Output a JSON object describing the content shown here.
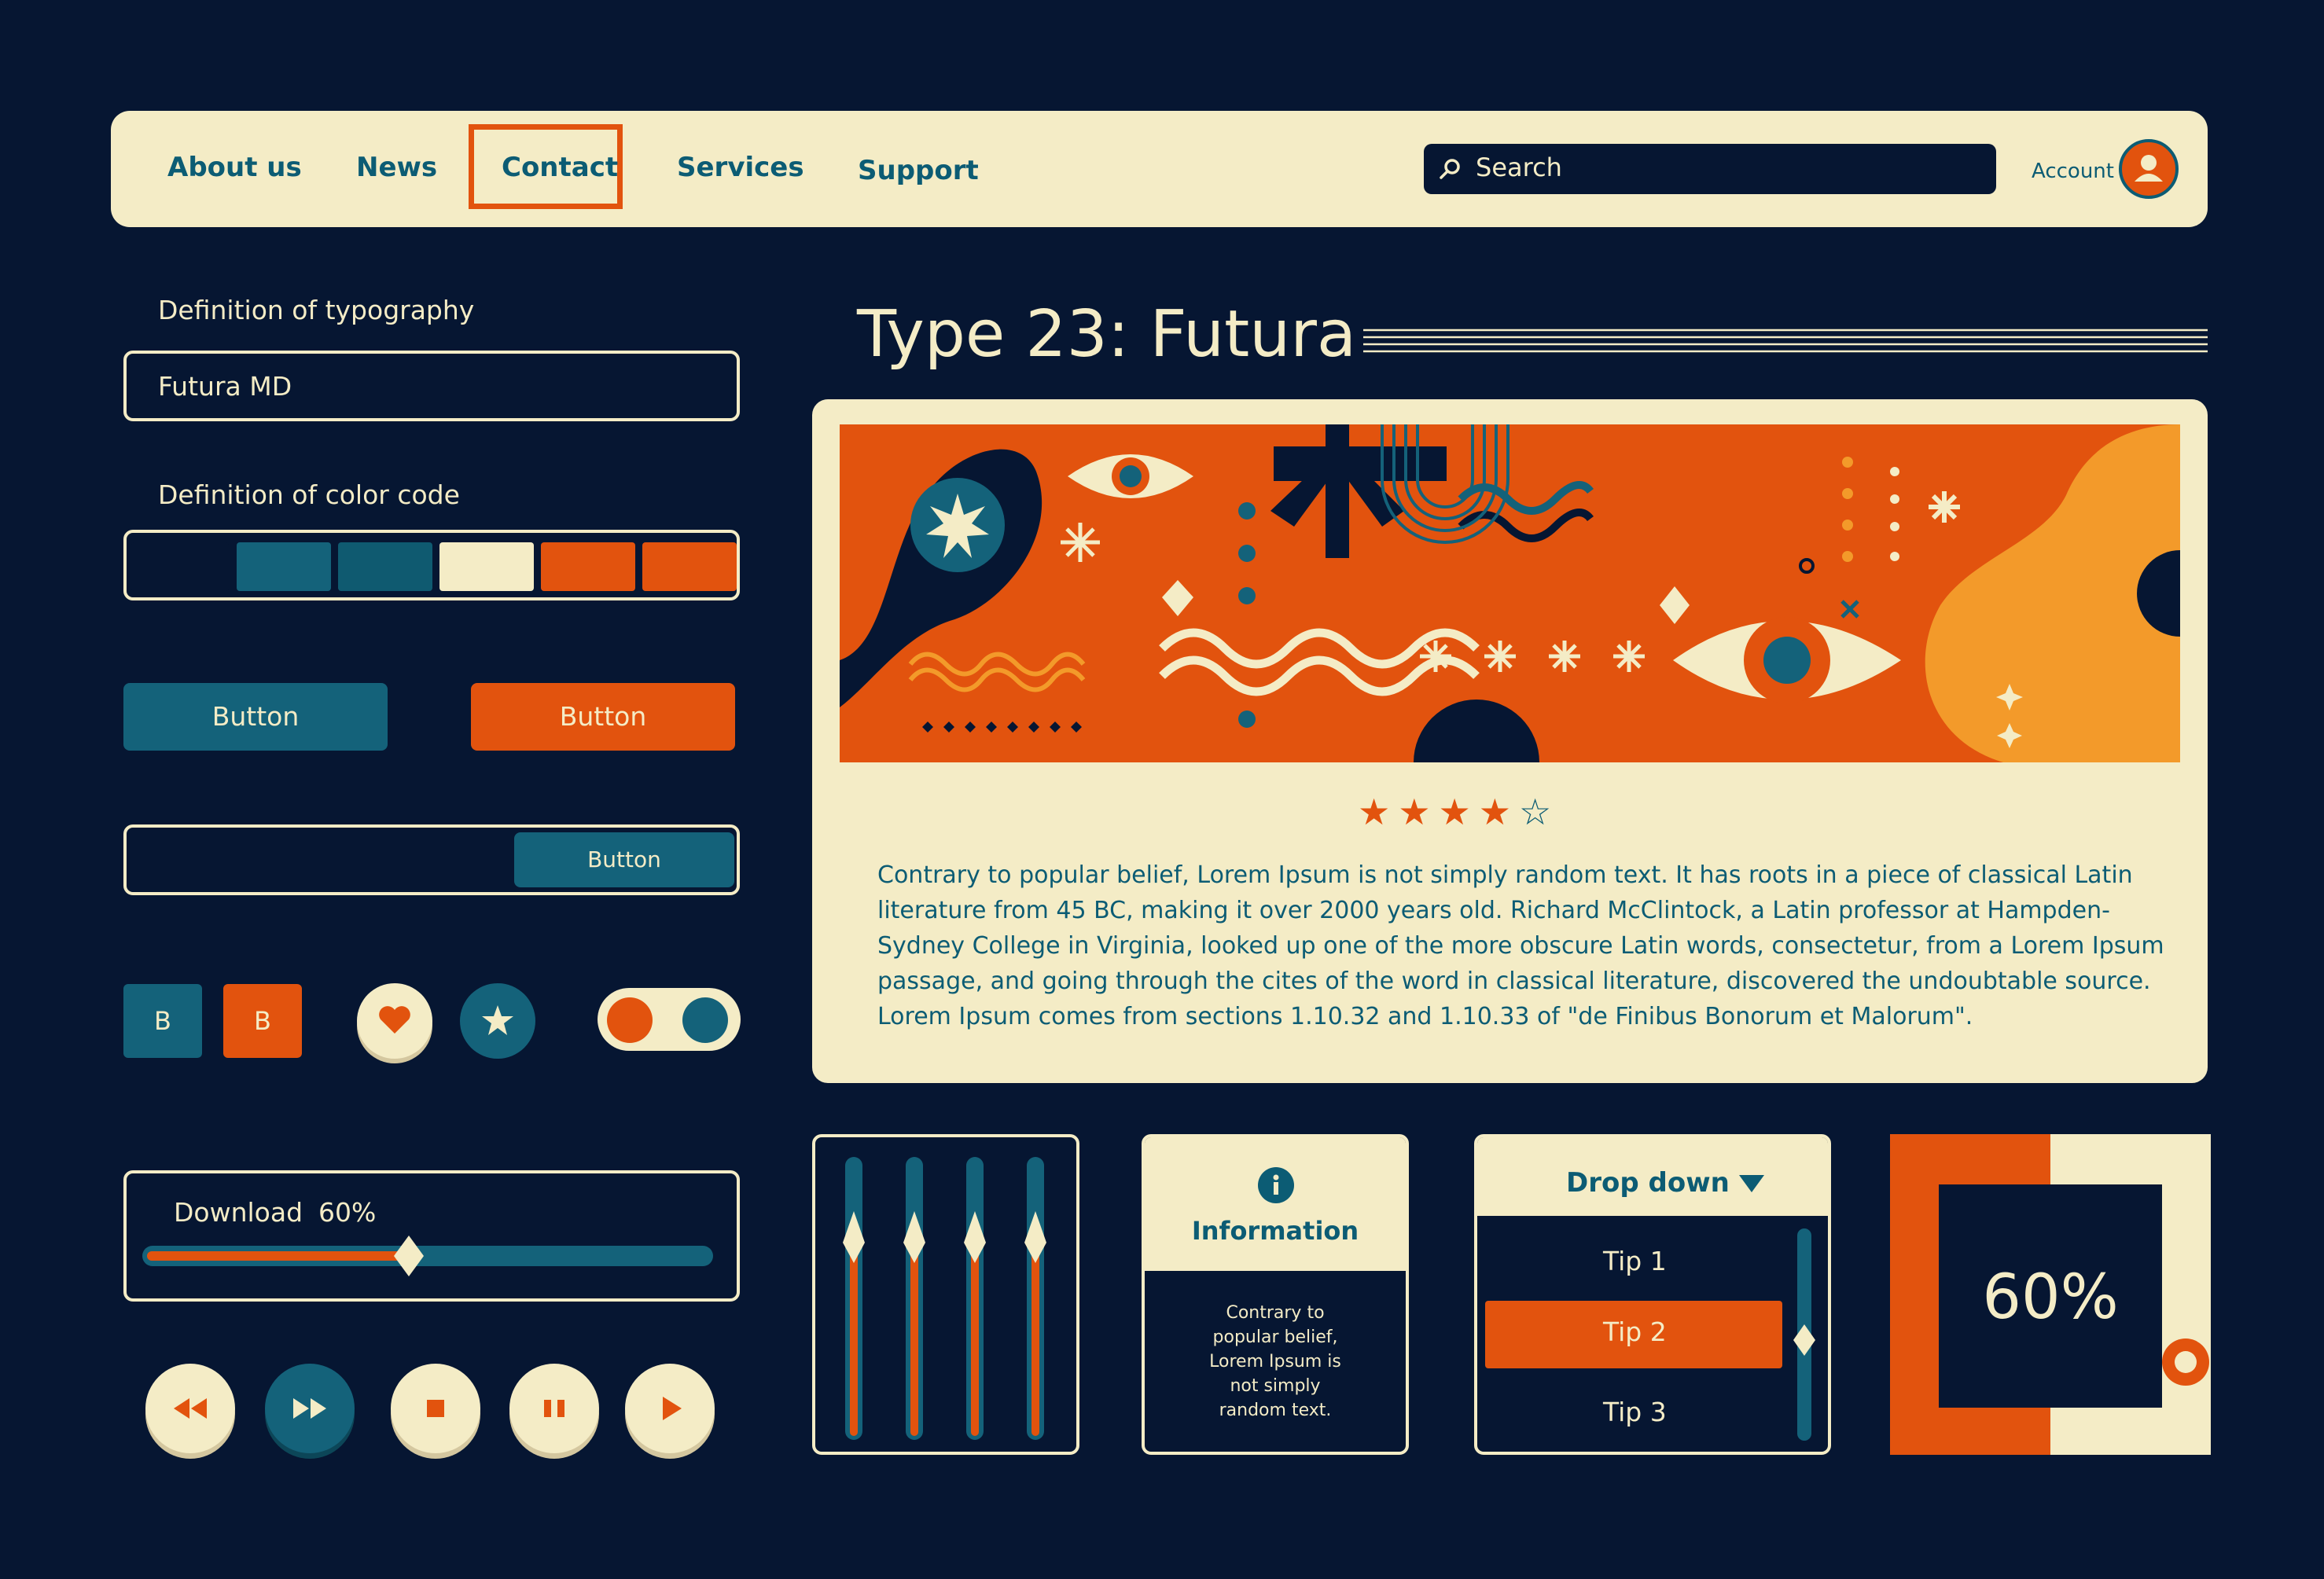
{
  "nav": {
    "items": [
      "About us",
      "News",
      "Contact",
      "Services",
      "Support"
    ],
    "active": "Contact",
    "search_placeholder": "Search",
    "account_label": "Account"
  },
  "left": {
    "typography_label": "Definition of typography",
    "typography_value": "Futura MD",
    "color_label": "Definition of color code",
    "colors": [
      "#061632",
      "#14627a",
      "#0f5a70",
      "#f4ecc6",
      "#e2530e",
      "#e2530e"
    ],
    "button_teal": "Button",
    "button_orange": "Button",
    "button_inline": "Button",
    "square_b1": "B",
    "square_b2": "B",
    "download_label": "Download",
    "download_pct": "60%",
    "download_progress": 0.6
  },
  "main": {
    "title": "Type 23: Futura",
    "rating": 4,
    "rating_max": 5,
    "paragraph": "Contrary to popular belief, Lorem Ipsum is not simply random text. It has roots in a piece of classical Latin literature from 45 BC, making it over 2000 years old. Richard McClintock, a Latin professor at Hampden-Sydney College in Virginia, looked up one of the more obscure Latin words, consectetur, from a Lorem Ipsum passage, and going through the cites of the word in classical literature, discovered the undoubtable source. Lorem Ipsum comes from sections 1.10.32 and 1.10.33 of \"de Finibus Bonorum et Malorum\"."
  },
  "info_card": {
    "title": "Information",
    "icon": "info-icon",
    "body": "Contrary to popular belief, Lorem Ipsum is not simply random text."
  },
  "dropdown": {
    "label": "Drop down",
    "options": [
      "Tip 1",
      "Tip 2",
      "Tip 3"
    ],
    "selected": "Tip 2"
  },
  "percent_widget": {
    "value": "60%"
  },
  "icons": [
    "search-icon",
    "user-icon",
    "heart-icon",
    "star-icon",
    "rewind-icon",
    "fast-forward-icon",
    "stop-icon",
    "pause-icon",
    "play-icon",
    "info-icon",
    "caret-down-icon"
  ]
}
